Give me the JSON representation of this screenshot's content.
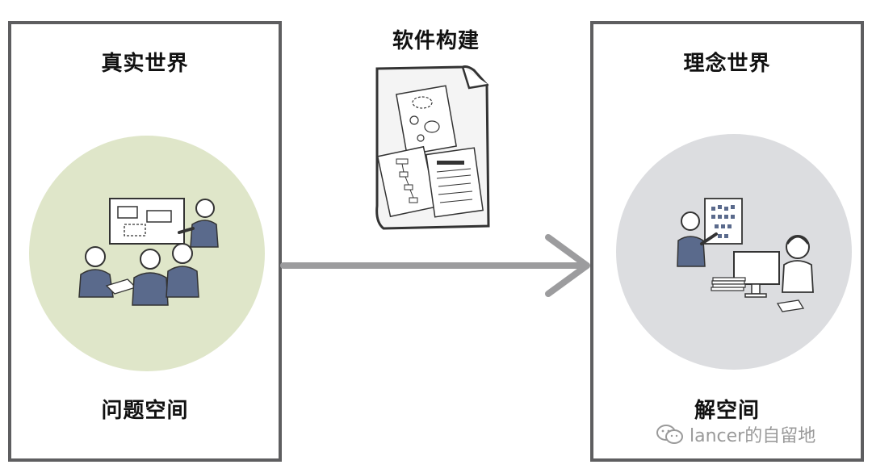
{
  "left_panel": {
    "top_title": "真实世界",
    "bottom_title": "问题空间"
  },
  "center": {
    "title": "软件构建"
  },
  "right_panel": {
    "top_title": "理念世界",
    "bottom_title": "解空间"
  },
  "watermark": {
    "text": "lancer的自留地"
  },
  "colors": {
    "border": "#5e5e60",
    "left_circle": "#dfe6c9",
    "right_circle": "#dcdde0",
    "figure_fill": "#5a6a8c",
    "arrow": "#9c9c9e",
    "watermark": "#9a9a9a"
  }
}
